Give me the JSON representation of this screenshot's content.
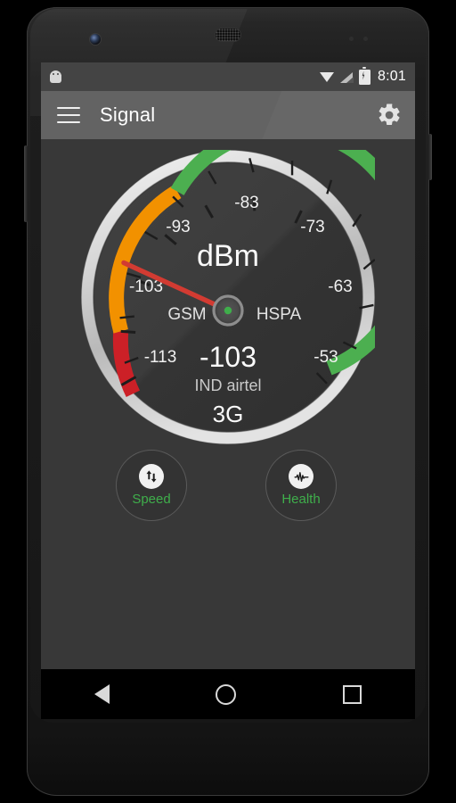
{
  "device": {
    "name": "android-phone-mockup",
    "camera_icon": "front-camera",
    "speaker_icon": "earpiece-speaker"
  },
  "status_bar": {
    "notification_icon": "android-robot-icon",
    "wifi_icon": "wifi-icon",
    "signal_icon": "cellular-signal-icon",
    "battery_icon": "battery-charging-icon",
    "time": "8:01",
    "background_color": "#444444"
  },
  "app_bar": {
    "menu_icon": "hamburger-menu-icon",
    "title": "Signal",
    "settings_icon": "gear-icon",
    "background_color": "#636363"
  },
  "gauge": {
    "unit_label": "dBm",
    "value": "-103",
    "carrier": "IND airtel",
    "network_type": "3G",
    "left_mode_label": "GSM",
    "right_mode_label": "HSPA",
    "tick_labels": [
      "-113",
      "-103",
      "-93",
      "-83",
      "-73",
      "-63",
      "-53"
    ],
    "needle_color": "#d23b32",
    "hub_dot_color": "#3fae4b",
    "bezel_color": "#d4d4d4",
    "face_color": "#3a3a3a"
  },
  "chart_data": {
    "type": "gauge",
    "title": "dBm",
    "value": -103,
    "display_value": "-103",
    "unit": "dBm",
    "min": -118,
    "max": -48,
    "ticks": [
      -113,
      -103,
      -93,
      -83,
      -73,
      -63,
      -53
    ],
    "tick_interval": 10,
    "minor_tick_interval": 5,
    "start_angle_deg": 215,
    "end_angle_deg": -35,
    "bands": [
      {
        "name": "poor",
        "from": -118,
        "to": -100,
        "color": "#cc2027"
      },
      {
        "name": "fair",
        "from": -100,
        "to": -90,
        "color": "#f29100"
      },
      {
        "name": "good",
        "from": -90,
        "to": -48,
        "color": "#4caf50"
      }
    ],
    "annotations": [
      "GSM",
      "HSPA",
      "IND airtel",
      "3G"
    ],
    "grid": false,
    "legend": "none"
  },
  "buttons": [
    {
      "id": "speed",
      "label": "Speed",
      "icon": "up-down-arrows-icon",
      "label_color": "#3fae4b"
    },
    {
      "id": "health",
      "label": "Health",
      "icon": "pulse-waveform-icon",
      "label_color": "#3fae4b"
    }
  ],
  "nav_bar": {
    "back_icon": "back-triangle-icon",
    "home_icon": "home-circle-icon",
    "recents_icon": "recents-square-icon",
    "background_color": "#000000"
  }
}
